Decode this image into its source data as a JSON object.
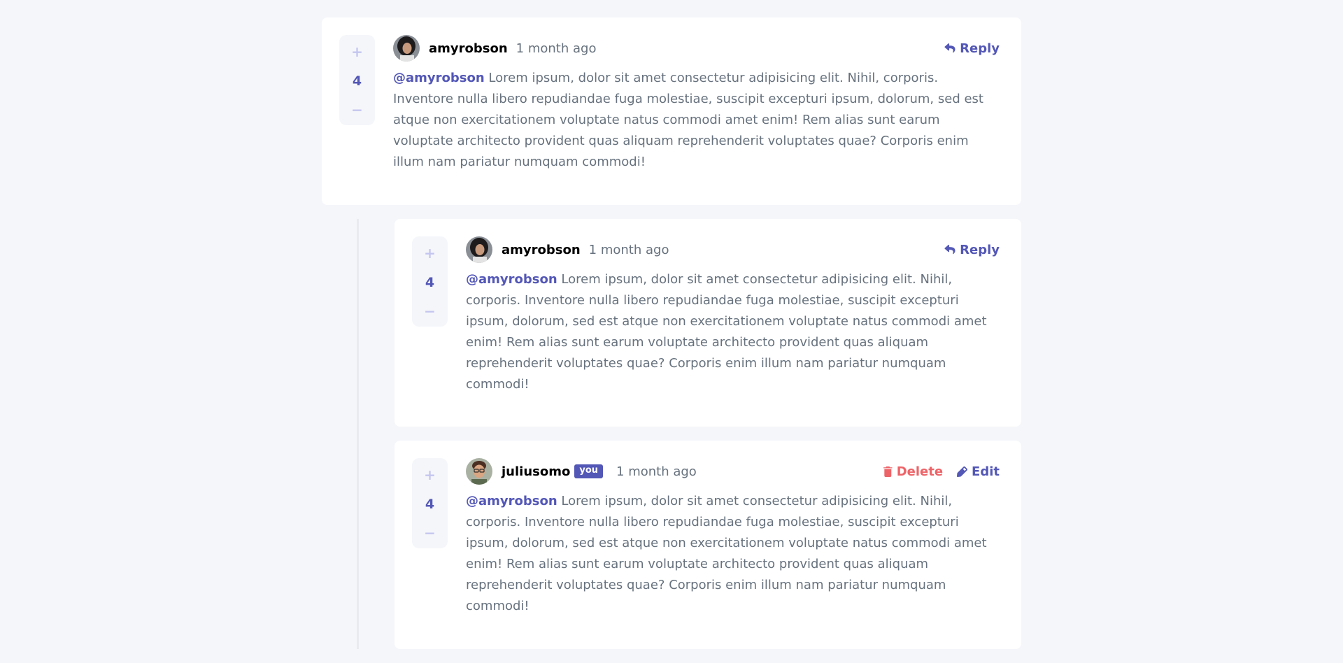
{
  "comments": {
    "top": {
      "score": "4",
      "username": "amyrobson",
      "time": "1 month ago",
      "reply_label": "Reply",
      "mention": "@amyrobson",
      "content": "Lorem ipsum, dolor sit amet consectetur adipisicing elit. Nihil, corporis. Inventore nulla libero repudiandae fuga molestiae, suscipit excepturi ipsum, dolorum, sed est atque non exercitationem voluptate natus commodi amet enim! Rem alias sunt earum voluptate architecto provident quas aliquam reprehenderit voluptates quae? Corporis enim illum nam pariatur numquam commodi!"
    },
    "replies": [
      {
        "score": "4",
        "username": "amyrobson",
        "time": "1 month ago",
        "reply_label": "Reply",
        "mention": "@amyrobson",
        "content": "Lorem ipsum, dolor sit amet consectetur adipisicing elit. Nihil, corporis. Inventore nulla libero repudiandae fuga molestiae, suscipit excepturi ipsum, dolorum, sed est atque non exercitationem voluptate natus commodi amet enim! Rem alias sunt earum voluptate architecto provident quas aliquam reprehenderit voluptates quae? Corporis enim illum nam pariatur numquam commodi!"
      },
      {
        "score": "4",
        "username": "juliusomo",
        "you_badge": "you",
        "time": "1 month ago",
        "delete_label": "Delete",
        "edit_label": "Edit",
        "mention": "@amyrobson",
        "content": "Lorem ipsum, dolor sit amet consectetur adipisicing elit. Nihil, corporis. Inventore nulla libero repudiandae fuga molestiae, suscipit excepturi ipsum, dolorum, sed est atque non exercitationem voluptate natus commodi amet enim! Rem alias sunt earum voluptate architecto provident quas aliquam reprehenderit voluptates quae? Corporis enim illum nam pariatur numquam commodi!"
      }
    ]
  },
  "vote": {
    "plus": "+",
    "minus": "−"
  },
  "icons": {
    "reply": "reply-arrow-icon",
    "delete": "trash-icon",
    "edit": "pencil-icon",
    "avatar_amy": "avatar-amyrobson",
    "avatar_julius": "avatar-juliusomo"
  },
  "colors": {
    "background": "#f5f6fa",
    "card": "#ffffff",
    "accent": "#5357b6",
    "accent_light": "#c5c6ef",
    "danger": "#ed6468",
    "text": "#67727e",
    "username": "#000000"
  }
}
